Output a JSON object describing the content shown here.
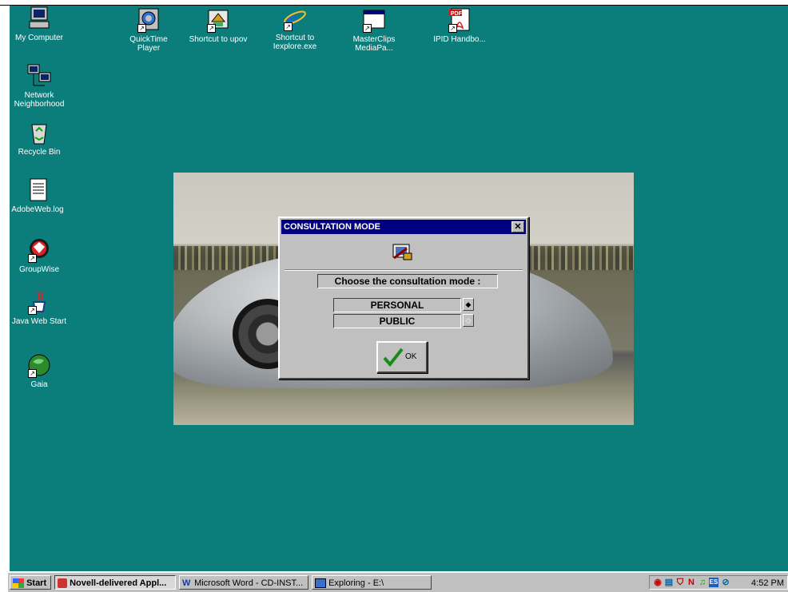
{
  "desktop": {
    "icons": [
      {
        "label": "My Computer"
      },
      {
        "label": "Network Neighborhood"
      },
      {
        "label": "Recycle Bin"
      },
      {
        "label": "AdobeWeb.log"
      },
      {
        "label": "GroupWise"
      },
      {
        "label": "Java Web Start"
      },
      {
        "label": "Gaia"
      },
      {
        "label": "QuickTime Player"
      },
      {
        "label": "Shortcut to upov"
      },
      {
        "label": "Shortcut to Iexplore.exe"
      },
      {
        "label": "MasterClips MediaPa..."
      },
      {
        "label": "IPID Handbo..."
      }
    ],
    "background_color": "#0b7e7c"
  },
  "dialog": {
    "title": "CONSULTATION MODE",
    "close_glyph": "✕",
    "prompt": "Choose the consultation mode :",
    "options": [
      {
        "label": "PERSONAL",
        "selected": true
      },
      {
        "label": "PUBLIC",
        "selected": false
      }
    ],
    "ok_label": "OK",
    "title_color": "#000080"
  },
  "taskbar": {
    "start_label": "Start",
    "tasks": [
      {
        "label": "Novell-delivered Appl..."
      },
      {
        "label": "Microsoft Word - CD-INST..."
      },
      {
        "label": "Exploring - E:\\"
      }
    ],
    "clock": "4:52 PM"
  }
}
